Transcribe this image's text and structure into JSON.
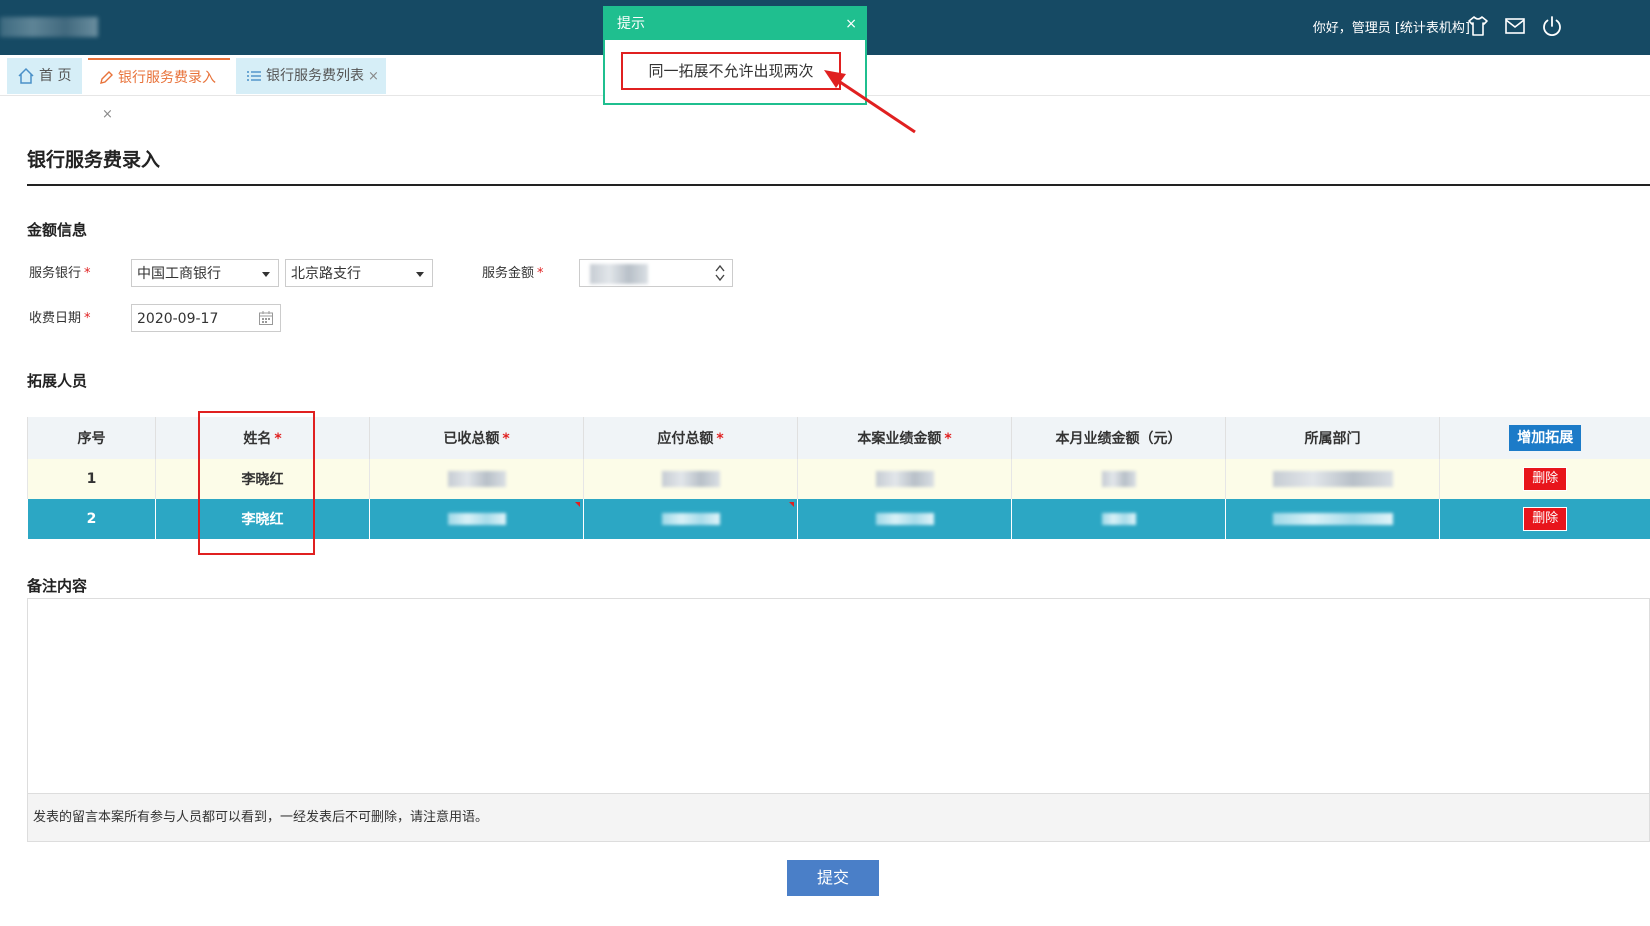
{
  "header": {
    "greeting": "你好，管理员 [统计表机构]",
    "icons": [
      "shirt-icon",
      "mail-icon",
      "power-icon"
    ]
  },
  "tabs": [
    {
      "label": "首 页",
      "icon": "home-icon"
    },
    {
      "label": "银行服务费录入",
      "icon": "edit-icon",
      "close": "×"
    },
    {
      "label": "银行服务费列表",
      "icon": "list-icon",
      "close": "×"
    }
  ],
  "toast": {
    "title": "提示",
    "close": "×",
    "message": "同一拓展不允许出现两次"
  },
  "page": {
    "title": "银行服务费录入"
  },
  "amount_section": {
    "heading": "金额信息",
    "bank_label": "服务银行",
    "bank_value": "中国工商银行",
    "branch_value": "北京路支行",
    "amount_label": "服务金额",
    "date_label": "收费日期",
    "date_value": "2020-09-17",
    "required_mark": "*"
  },
  "staff_section": {
    "heading": "拓展人员",
    "columns": [
      "序号",
      "姓名",
      "已收总额",
      "应付总额",
      "本案业绩金额",
      "本月业绩金额（元）",
      "所属部门"
    ],
    "add_button": "增加拓展",
    "rows": [
      {
        "index": "1",
        "name": "李晓红",
        "delete": "删除"
      },
      {
        "index": "2",
        "name": "李晓红",
        "delete": "删除"
      }
    ]
  },
  "remarks_section": {
    "heading": "备注内容",
    "note": "发表的留言本案所有参与人员都可以看到，一经发表后不可删除，请注意用语。"
  },
  "submit_label": "提交",
  "colors": {
    "topbar": "#164a64",
    "toast_green": "#1fbf8f",
    "selected_row": "#2ca7c4",
    "delete_red": "#e8151b",
    "add_blue": "#1c7bc8",
    "submit_blue": "#4a7fc8"
  }
}
